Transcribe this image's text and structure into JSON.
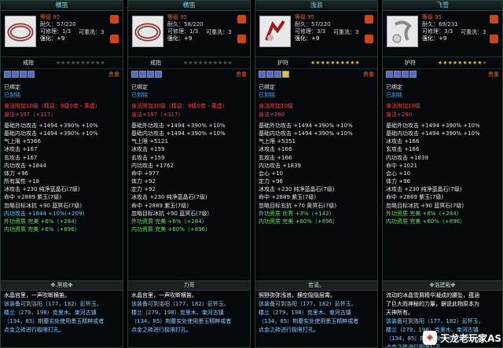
{
  "panels": [
    {
      "title": "横笛",
      "level": "等级 95",
      "durability": "耐久：57/220",
      "repair": "可修理：1/3",
      "wash": "可重洗：3",
      "strength": "强化：+9",
      "type": "戒指",
      "goods": "贵重",
      "stars_on": 0,
      "gems": [
        "b",
        "b",
        "b",
        "b"
      ],
      "lines": [
        {
          "t": "已绑定",
          "c": "w"
        },
        {
          "t": "已刻铭",
          "c": "b"
        },
        {
          "t": "身法附加10级（精益：9级0帝・乘虚）",
          "c": "r"
        },
        {
          "t": "身法+597（+317）",
          "c": "r"
        },
        {
          "t": "基础外功攻击 +1494 +390% +10%",
          "c": "w"
        },
        {
          "t": "基础内功攻击 +1494 +390% +10%",
          "c": "w"
        },
        {
          "t": "气上限 +5366",
          "c": "w"
        },
        {
          "t": "冰攻击 +167",
          "c": "w"
        },
        {
          "t": "玄攻击 +167",
          "c": "w"
        },
        {
          "t": "内功攻击 +1844",
          "c": "w"
        },
        {
          "t": "体力 +96",
          "c": "w"
        },
        {
          "t": "所有属性 +18",
          "c": "w"
        },
        {
          "t": "冰攻击 +230 纯净蓝晶石(7级)",
          "c": "w"
        },
        {
          "t": "命中 +2889 紫玉(7级)",
          "c": "w"
        },
        {
          "t": "忽略目标冰抗 +90 蓝冥石(7级)",
          "c": "w"
        },
        {
          "t": "内功攻击 +1844 +10%(+209)",
          "c": "c"
        },
        {
          "t": "外功资质   完美 +6%（+284）",
          "c": "g"
        },
        {
          "t": "内功资质   完美 +6%（+896）",
          "c": "g"
        }
      ],
      "sep": "✤.黑桃✤",
      "desc": [
        "水晶宫里，一声吹断横笛。",
        "该装备可到洛阳（177，182）彭怀玉、",
        "楼兰（279，198）克里木、束河古镇",
        "（134，85）荆蘼实处使用墨玉精粹或者",
        "点金之砖进行极限打孔。"
      ]
    },
    {
      "title": "横笛",
      "level": "等级 95",
      "durability": "耐久：58/220",
      "repair": "可修理：1/3",
      "wash": "可重洗：3",
      "strength": "强化：+9",
      "type": "戒指",
      "goods": "贵重",
      "stars_on": 0,
      "gems": [
        "b",
        "b",
        "b",
        "b"
      ],
      "lines": [
        {
          "t": "已绑定",
          "c": "w"
        },
        {
          "t": "已刻铭",
          "c": "b"
        },
        {
          "t": "身法附加10级（精益：9级0帝・乘虚）",
          "c": "r"
        },
        {
          "t": "身法+597（+317）",
          "c": "r"
        },
        {
          "t": "基础外功攻击 +1494 +390% +10%",
          "c": "w"
        },
        {
          "t": "基础内功攻击 +1494 +390% +10%",
          "c": "w"
        },
        {
          "t": "气上限 +5121",
          "c": "w"
        },
        {
          "t": "冰攻击 +159",
          "c": "w"
        },
        {
          "t": "玄攻击 +159",
          "c": "w"
        },
        {
          "t": "内功攻击 +1762",
          "c": "w"
        },
        {
          "t": "命中 +977",
          "c": "w"
        },
        {
          "t": "体力 +92",
          "c": "w"
        },
        {
          "t": "定力 +92",
          "c": "w"
        },
        {
          "t": "冰攻击 +230 纯净蓝晶石(7级)",
          "c": "w"
        },
        {
          "t": "命中 +2889 紫玉(7级)",
          "c": "w"
        },
        {
          "t": "忽略目标冰抗 +90 蓝冥石(7级)",
          "c": "w"
        },
        {
          "t": "外功资质   完美 +6%（+284）",
          "c": "g"
        },
        {
          "t": "内功资质   完美 +60%（+896）",
          "c": "g"
        }
      ],
      "sep": "力哥",
      "desc": [
        "水晶宫里，一声吹断横笛。",
        "该装备可到洛阳（177，182）彭怀玉、",
        "楼兰（279，198）克里木、束河古镇",
        "（134，85）荆蘼实处使用墨玉精粹或者",
        "点金之砖进行极限打孔。"
      ]
    },
    {
      "title": "浅浪",
      "level": "等级 95",
      "durability": "耐久：57/220",
      "repair": "可修理：3/3",
      "wash": "可重洗：3",
      "strength": "强化：+9",
      "type": "护符",
      "goods": "贵重",
      "stars_on": 10,
      "gems": [
        "b",
        "b",
        "b",
        "y"
      ],
      "lines": [
        {
          "t": "已绑定",
          "c": "w"
        },
        {
          "t": "已刻铭",
          "c": "b"
        },
        {
          "t": "身法附加10级",
          "c": "r"
        },
        {
          "t": "身法+280",
          "c": "r"
        },
        {
          "t": "基础外功攻击 +1494 +390% +10%",
          "c": "w"
        },
        {
          "t": "基础内功攻击 +1494 +390% +10%",
          "c": "w"
        },
        {
          "t": "气上限 +5351",
          "c": "w"
        },
        {
          "t": "冰攻击 +166",
          "c": "w"
        },
        {
          "t": "玄攻击 +166",
          "c": "w"
        },
        {
          "t": "内功攻击 +1839",
          "c": "w"
        },
        {
          "t": "会心 +10",
          "c": "w"
        },
        {
          "t": "定力 +96",
          "c": "w"
        },
        {
          "t": "冰攻击 +230 纯净蓝晶石(7级)",
          "c": "w"
        },
        {
          "t": "命中 +2889 紫玉(7级)",
          "c": "w"
        },
        {
          "t": "忽略目标玄抗 +70 黄冥石(7级)",
          "c": "w"
        },
        {
          "t": "外功资质   优秀 +3%（+142）",
          "c": "g"
        },
        {
          "t": "内功资质   完美 +60%（+896）",
          "c": "g"
        }
      ],
      "sep": "若凌。",
      "desc": [
        "照野弥弥浅浪，横空隐隐层霄。",
        "该装备可到洛阳（177，182）彭怀玉、",
        "楼兰（279，198）克里木、束河古镇",
        "（134，85）荆蘼实处使用墨玉精粹或者",
        "点金之砖进行极限打孔。"
      ]
    },
    {
      "title": "飞雪",
      "level": "等级 95",
      "durability": "耐久：69/231",
      "repair": "可修理：3/3",
      "wash": "可重洗：3",
      "strength": "强化：+9",
      "type": "护符",
      "goods": "贵重",
      "stars_on": 9,
      "gems": [
        "b",
        "b",
        "b",
        "b"
      ],
      "lines": [
        {
          "t": "已绑定",
          "c": "w"
        },
        {
          "t": "已刻铭",
          "c": "b"
        },
        {
          "t": "身法附加10级",
          "c": "r"
        },
        {
          "t": "身法+280",
          "c": "r"
        },
        {
          "t": "基础外功攻击 +1494 +390% +10%",
          "c": "w"
        },
        {
          "t": "基础内功攻击 +1494 +390% +10%",
          "c": "w"
        },
        {
          "t": "冰攻击 +166",
          "c": "w"
        },
        {
          "t": "玄攻击 +166",
          "c": "w"
        },
        {
          "t": "内功攻击 +1839",
          "c": "w"
        },
        {
          "t": "命中 +1021",
          "c": "w"
        },
        {
          "t": "会心 +10",
          "c": "w"
        },
        {
          "t": "体力 +96",
          "c": "w"
        },
        {
          "t": "冰攻击 +230 纯净蓝晶石(7级)",
          "c": "w"
        },
        {
          "t": "命中 +2889 紫玉(7级)",
          "c": "w"
        },
        {
          "t": "忽略目标冰抗 +90 蓝冥石(7级)",
          "c": "w"
        },
        {
          "t": "外功资质   完美 +6%（+284）",
          "c": "g"
        },
        {
          "t": "内功资质   完美 +60%（+896）",
          "c": "g"
        }
      ],
      "sep": "✤浩建殿✤",
      "desc": [
        "流动的冰晶雪屑精华凝成的腰坠，蕴涵",
        "了巨大而神秘的力量，据说此物原本为",
        "天神所有。",
        "该装备可到洛阳（177，182）彭怀玉、",
        "楼兰（279，198）克里木、束河古镇",
        "（134，85）荆蘼实处使用墨玉精粹或者",
        "点金之砖进行极限打孔。"
      ]
    }
  ],
  "watermark": "天龙老玩家AS",
  "colors": {
    "bg": "#000000",
    "red": "#ff4040",
    "green": "#6ae06a",
    "cyan": "#55d8ff",
    "blue": "#55aaff"
  }
}
